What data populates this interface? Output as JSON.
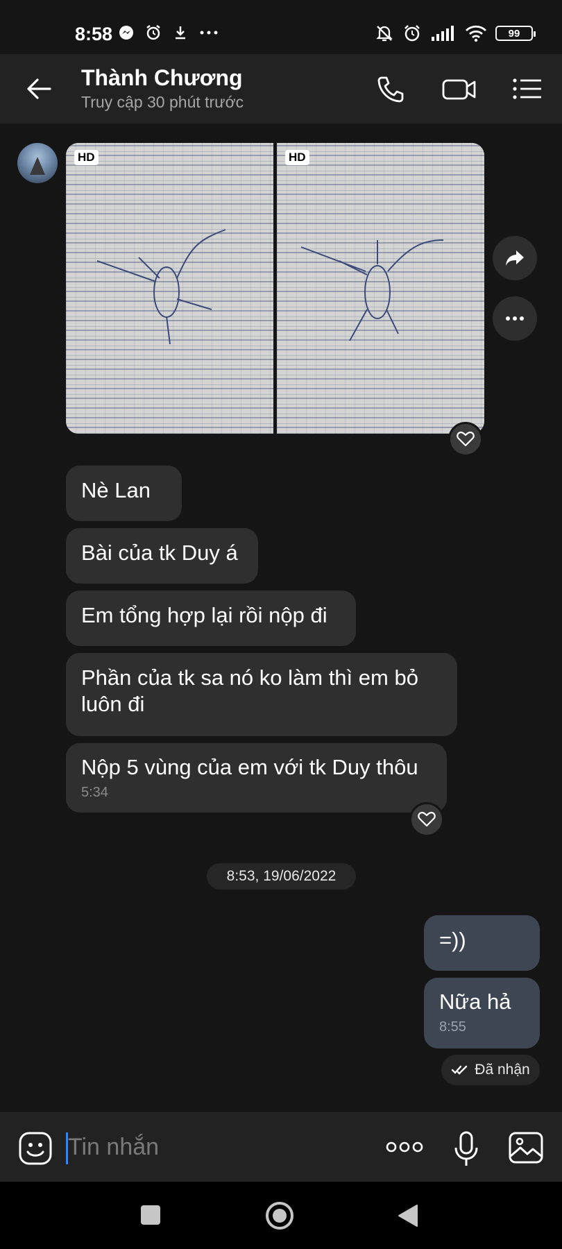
{
  "status_bar": {
    "time": "8:58",
    "battery": "99"
  },
  "header": {
    "contact_name": "Thành Chương",
    "contact_status": "Truy cập 30 phút trước"
  },
  "photos": [
    {
      "badge": "HD"
    },
    {
      "badge": "HD"
    }
  ],
  "messages_in": [
    {
      "text": "Nè Lan"
    },
    {
      "text": "Bài của tk Duy á"
    },
    {
      "text": "Em tổng hợp lại rồi nộp đi"
    },
    {
      "text": "Phần của tk sa nó ko làm thì em bỏ luôn đi"
    },
    {
      "text": "Nộp 5 vùng của em với tk Duy thôu",
      "time": "5:34"
    }
  ],
  "date_separator": "8:53, 19/06/2022",
  "messages_out": [
    {
      "text": "=))"
    },
    {
      "text": "Nữa hả",
      "time": "8:55"
    }
  ],
  "receipt": "Đã nhận",
  "composer": {
    "placeholder": "Tin nhắn"
  },
  "colors": {
    "background": "#151515",
    "bubble_in": "#2f2f2f",
    "bubble_out": "#3e4654",
    "cursor": "#2f84ff"
  }
}
